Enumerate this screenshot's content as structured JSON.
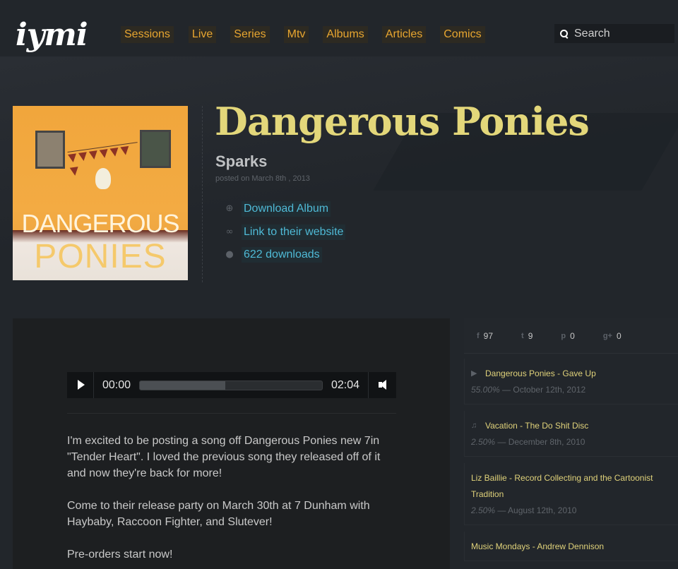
{
  "brand": {
    "logo": "iymi"
  },
  "nav": {
    "items": [
      "Sessions",
      "Live",
      "Series",
      "Mtv",
      "Albums",
      "Articles",
      "Comics"
    ]
  },
  "search": {
    "placeholder": "Search",
    "value": ""
  },
  "album": {
    "title": "Dangerous Ponies",
    "artist": "Sparks",
    "posted": "posted on March 8th , 2013",
    "cover_text_1": "DANGEROUS",
    "cover_text_2": "PONIES",
    "links": [
      {
        "icon": "download-icon",
        "label": "Download Album"
      },
      {
        "icon": "link-icon",
        "label": "Link to their website"
      },
      {
        "icon": "user-icon",
        "label": "622 downloads"
      }
    ]
  },
  "player": {
    "current_time": "00:00",
    "duration": "02:04",
    "buffered_fraction": 0.47
  },
  "post": {
    "paragraphs": [
      "I'm excited to be posting a song off Dangerous Ponies new 7in \"Tender Heart\". I loved the previous song they released off of it and now they're back for more!",
      "Come to their release party on March 30th at 7 Dunham with Haybaby, Raccoon Fighter, and Slutever!",
      "Pre-orders start now!"
    ]
  },
  "share": [
    {
      "icon": "facebook-icon",
      "glyph": "f",
      "count": "97"
    },
    {
      "icon": "twitter-icon",
      "glyph": "t",
      "count": "9"
    },
    {
      "icon": "pinterest-icon",
      "glyph": "p",
      "count": "0"
    },
    {
      "icon": "googleplus-icon",
      "glyph": "g+",
      "count": "0"
    }
  ],
  "related": [
    {
      "icon": "video-icon",
      "glyph": "▶",
      "title": "Dangerous Ponies - Gave Up",
      "percent": "55.00%",
      "date": "— October 12th, 2012"
    },
    {
      "icon": "music-icon",
      "glyph": "♫",
      "title": "Vacation - The Do Shit Disc",
      "percent": "2.50%",
      "date": "— December 8th, 2010"
    },
    {
      "icon": "",
      "glyph": "",
      "title": "Liz Baillie - Record Collecting and the Cartoonist Tradition",
      "percent": "2.50%",
      "date": "— August 12th, 2010"
    },
    {
      "icon": "",
      "glyph": "",
      "title": "Music Mondays - Andrew Dennison",
      "percent": "",
      "date": ""
    }
  ]
}
